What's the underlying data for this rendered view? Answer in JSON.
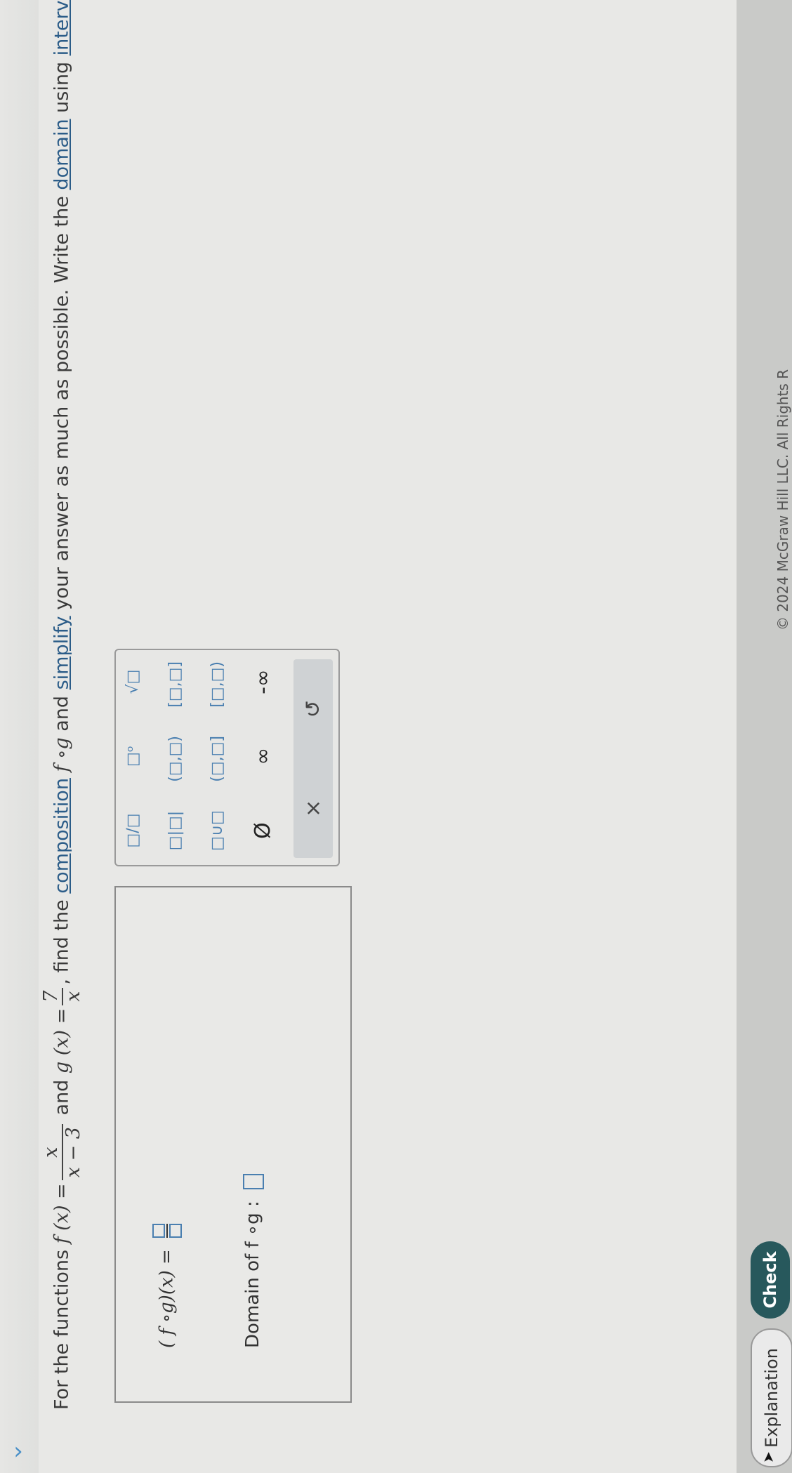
{
  "question": {
    "prefix": "For the functions ",
    "f_label": "f (x) =",
    "f_num": "x",
    "f_den": "x − 3",
    "and": " and ",
    "g_label": "g (x) =",
    "g_num": "7",
    "g_den": "x",
    "mid": ", find the ",
    "link_composition": "composition",
    "comp_expr": " f ∘g",
    "and2": " and ",
    "link_simplify": "simplify",
    "mid2": " your answer as much as possible. Write the ",
    "link_domain": "domain",
    "mid3": " using ",
    "link_interval": "interval notation",
    "end": "."
  },
  "answer": {
    "composition_label": "( f ∘g)(x) =",
    "domain_label": "Domain of f ∘g :"
  },
  "palette": {
    "row1": [
      "□/□",
      "□ᵒ",
      "√□"
    ],
    "row2": [
      "□|□|",
      "(□,□)",
      "[□,□]"
    ],
    "row3": [
      "□∪□",
      "(□,□]",
      "[□,□)"
    ],
    "row4": [
      "Ø",
      "∞",
      "-∞"
    ],
    "clear": "×",
    "undo": "↺"
  },
  "bottom": {
    "explanation_label": "Explanation",
    "check_label": "Check",
    "copyright": "© 2024 McGraw Hill LLC. All Rights R"
  },
  "colors": {
    "check_bg": "#27585c",
    "slot_blue": "#4a7fb0",
    "link": "#2b5c88"
  }
}
